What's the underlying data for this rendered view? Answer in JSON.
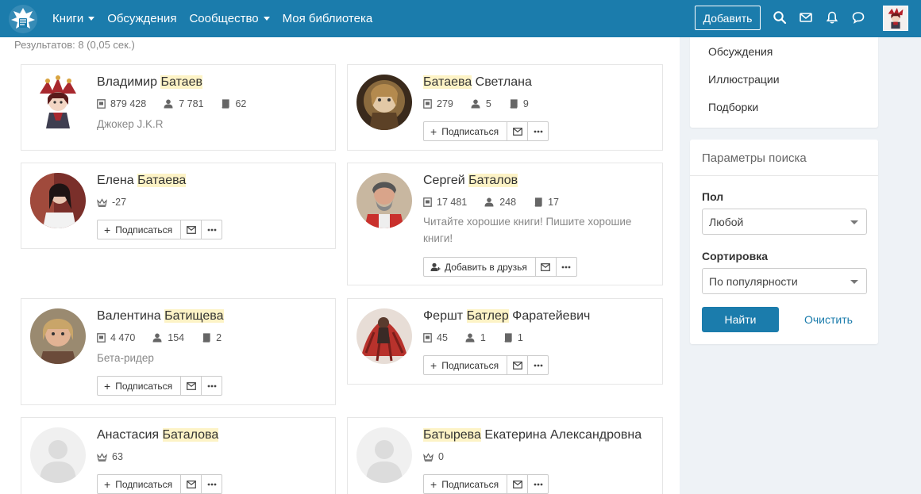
{
  "nav": {
    "items": [
      {
        "label": "Книги",
        "dropdown": true
      },
      {
        "label": "Обсуждения",
        "dropdown": false
      },
      {
        "label": "Сообщество",
        "dropdown": true
      },
      {
        "label": "Моя библиотека",
        "dropdown": false
      }
    ],
    "add_label": "Добавить"
  },
  "colors": {
    "accent": "#1b7cac",
    "highlight": "#fdf3c6"
  },
  "results_text": "Результатов: 8 (0,05 сек.)",
  "users": [
    {
      "pre": "Владимир ",
      "hl": "Батаев",
      "post": "",
      "stats": [
        {
          "icon": "book-icon",
          "value": "879 428"
        },
        {
          "icon": "followers-icon",
          "value": "7 781"
        },
        {
          "icon": "books-icon",
          "value": "62"
        }
      ],
      "tag": "Джокер J.K.R",
      "action": ""
    },
    {
      "pre": "",
      "hl": "Батаева",
      "post": " Светлана",
      "stats": [
        {
          "icon": "book-icon",
          "value": "279"
        },
        {
          "icon": "followers-icon",
          "value": "5"
        },
        {
          "icon": "books-icon",
          "value": "9"
        }
      ],
      "tag": "",
      "action": "Подписаться"
    },
    {
      "pre": "Елена ",
      "hl": "Батаева",
      "post": "",
      "stats": [
        {
          "icon": "crown-icon",
          "value": "-27"
        }
      ],
      "tag": "",
      "action": "Подписаться"
    },
    {
      "pre": "Сергей ",
      "hl": "Баталов",
      "post": "",
      "stats": [
        {
          "icon": "book-icon",
          "value": "17 481"
        },
        {
          "icon": "followers-icon",
          "value": "248"
        },
        {
          "icon": "books-icon",
          "value": "17"
        }
      ],
      "tag": "Читайте хорошие книги! Пишите хорошие книги!",
      "action": "Добавить в друзья"
    },
    {
      "pre": "Валентина ",
      "hl": "Батищева",
      "post": "",
      "stats": [
        {
          "icon": "book-icon",
          "value": "4 470"
        },
        {
          "icon": "followers-icon",
          "value": "154"
        },
        {
          "icon": "books-icon",
          "value": "2"
        }
      ],
      "tag": "Бета-ридер",
      "action": "Подписаться"
    },
    {
      "pre": "Фершт ",
      "hl": "Батлер",
      "post": " Фаратейевич",
      "stats": [
        {
          "icon": "book-icon",
          "value": "45"
        },
        {
          "icon": "followers-icon",
          "value": "1"
        },
        {
          "icon": "books-icon",
          "value": "1"
        }
      ],
      "tag": "",
      "action": "Подписаться"
    },
    {
      "pre": "Анастасия ",
      "hl": "Баталова",
      "post": "",
      "stats": [
        {
          "icon": "crown-icon",
          "value": "63"
        }
      ],
      "tag": "",
      "action": "Подписаться"
    },
    {
      "pre": "",
      "hl": "Батырева",
      "post": " Екатерина Александровна",
      "stats": [
        {
          "icon": "crown-icon",
          "value": "0"
        }
      ],
      "tag": "",
      "action": "Подписаться"
    }
  ],
  "sidebar": {
    "links": [
      "Обсуждения",
      "Иллюстрации",
      "Подборки"
    ],
    "params_title": "Параметры поиска",
    "gender_label": "Пол",
    "gender_value": "Любой",
    "sort_label": "Сортировка",
    "sort_value": "По популярности",
    "find_label": "Найти",
    "clear_label": "Очистить"
  }
}
